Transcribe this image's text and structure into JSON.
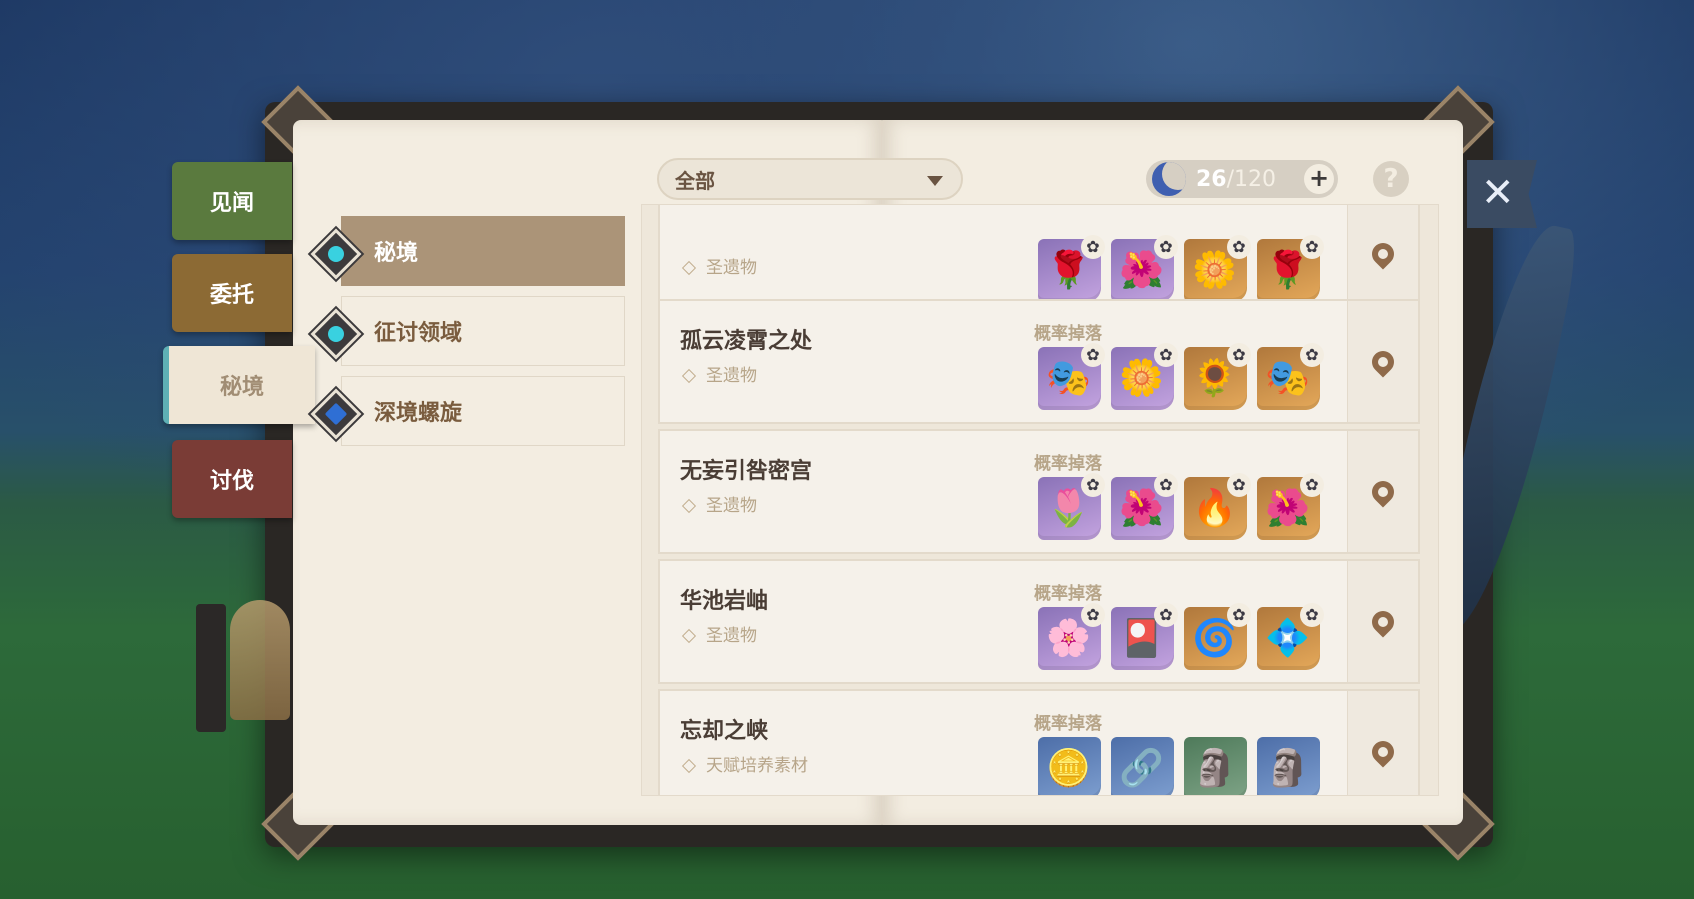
{
  "side_tabs": [
    "见闻",
    "委托",
    "秘境",
    "讨伐"
  ],
  "categories": [
    {
      "label": "秘境",
      "active": true,
      "icon": "domain-icon"
    },
    {
      "label": "征讨领域",
      "active": false,
      "icon": "trounce-domain-icon"
    },
    {
      "label": "深境螺旋",
      "active": false,
      "icon": "spiral-abyss-icon"
    }
  ],
  "filter": {
    "value": "全部"
  },
  "resin": {
    "current": "26",
    "max": "/120"
  },
  "rows": [
    {
      "name": "",
      "type": "圣遗物",
      "drop_label": "",
      "items": [
        {
          "rarity": "purple",
          "glyph": "🌹"
        },
        {
          "rarity": "purple",
          "glyph": "🌺"
        },
        {
          "rarity": "gold",
          "glyph": "🌼"
        },
        {
          "rarity": "gold",
          "glyph": "🌹"
        }
      ]
    },
    {
      "name": "孤云凌霄之处",
      "type": "圣遗物",
      "drop_label": "概率掉落",
      "items": [
        {
          "rarity": "purple",
          "glyph": "🎭"
        },
        {
          "rarity": "purple",
          "glyph": "🌼"
        },
        {
          "rarity": "gold",
          "glyph": "🌻"
        },
        {
          "rarity": "gold",
          "glyph": "🎭"
        }
      ]
    },
    {
      "name": "无妄引咎密宫",
      "type": "圣遗物",
      "drop_label": "概率掉落",
      "items": [
        {
          "rarity": "purple",
          "glyph": "🌷"
        },
        {
          "rarity": "purple",
          "glyph": "🌺"
        },
        {
          "rarity": "gold",
          "glyph": "🔥"
        },
        {
          "rarity": "gold",
          "glyph": "🌺"
        }
      ]
    },
    {
      "name": "华池岩岫",
      "type": "圣遗物",
      "drop_label": "概率掉落",
      "items": [
        {
          "rarity": "purple",
          "glyph": "🌸"
        },
        {
          "rarity": "purple",
          "glyph": "🎴"
        },
        {
          "rarity": "gold",
          "glyph": "🌀"
        },
        {
          "rarity": "gold",
          "glyph": "💠"
        }
      ]
    },
    {
      "name": "忘却之峡",
      "type": "天赋培养素材",
      "drop_label": "概率掉落",
      "items": [
        {
          "rarity": "blue",
          "glyph": "🪙"
        },
        {
          "rarity": "blue",
          "glyph": "🔗"
        },
        {
          "rarity": "green",
          "glyph": "🗿"
        },
        {
          "rarity": "blue",
          "glyph": "🗿"
        }
      ]
    }
  ],
  "icons": {
    "close": "close-icon",
    "help": "help-icon",
    "map_pin": "map-pin-icon",
    "resin": "original-resin-icon"
  }
}
